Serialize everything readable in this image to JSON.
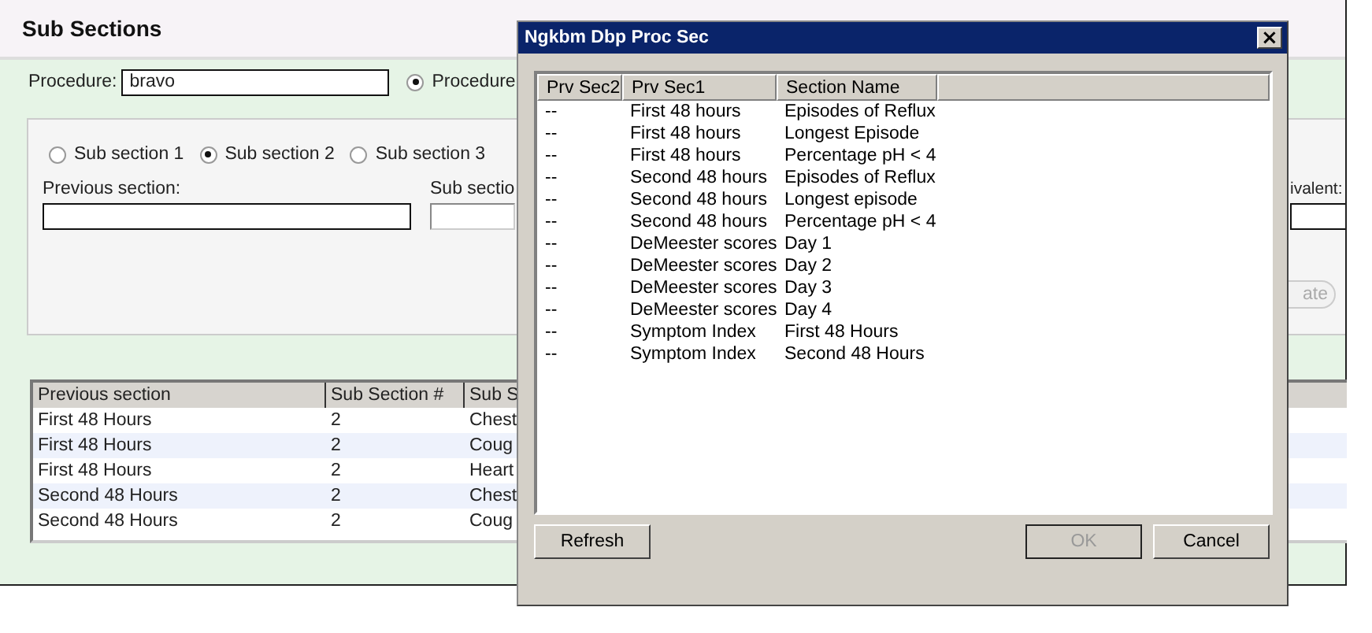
{
  "page": {
    "title": "Sub Sections"
  },
  "procedure": {
    "label": "Procedure:",
    "value": "bravo",
    "option": {
      "label": "Procedure",
      "selected": true
    }
  },
  "sub_section_options": [
    {
      "label": "Sub section 1",
      "selected": false
    },
    {
      "label": "Sub section 2",
      "selected": true
    },
    {
      "label": "Sub section 3",
      "selected": false
    }
  ],
  "fields": [
    {
      "label": "Previous section:"
    },
    {
      "label": "Sub sectio"
    },
    {
      "label": "ivalent:"
    }
  ],
  "update_button": {
    "label": "ate",
    "disabled": true
  },
  "table": {
    "columns": [
      "Previous section",
      "Sub Section #",
      "Sub S"
    ],
    "rows": [
      {
        "cells": [
          "First 48 Hours",
          "2",
          "Chest"
        ]
      },
      {
        "cells": [
          "First 48 Hours",
          "2",
          "Coug"
        ]
      },
      {
        "cells": [
          "First 48 Hours",
          "2",
          "Heart"
        ]
      },
      {
        "cells": [
          "Second 48 Hours",
          "2",
          "Chest"
        ]
      },
      {
        "cells": [
          "Second 48 Hours",
          "2",
          "Coug"
        ]
      }
    ]
  },
  "dialog": {
    "title": "Ngkbm Dbp Proc Sec",
    "close": "×",
    "columns": [
      "Prv Sec2",
      "Prv Sec1",
      "Section Name"
    ],
    "rows": [
      [
        "--",
        "First 48 hours",
        "Episodes of Reflux"
      ],
      [
        "--",
        "First 48 hours",
        "Longest Episode"
      ],
      [
        "--",
        "First 48 hours",
        "Percentage pH < 4"
      ],
      [
        "--",
        "Second 48 hours",
        "Episodes of Reflux"
      ],
      [
        "--",
        "Second 48 hours",
        "Longest episode"
      ],
      [
        "--",
        "Second 48 hours",
        "Percentage pH < 4"
      ],
      [
        "--",
        "DeMeester scores",
        "Day 1"
      ],
      [
        "--",
        "DeMeester scores",
        "Day 2"
      ],
      [
        "--",
        "DeMeester scores",
        "Day 3"
      ],
      [
        "--",
        "DeMeester scores",
        "Day 4"
      ],
      [
        "--",
        "Symptom Index",
        "First 48 Hours"
      ],
      [
        "--",
        "Symptom Index",
        "Second 48 Hours"
      ]
    ],
    "buttons": [
      {
        "label": "Refresh",
        "disabled": false
      },
      {
        "label": "OK",
        "disabled": true
      },
      {
        "label": "Cancel",
        "disabled": false
      }
    ]
  }
}
